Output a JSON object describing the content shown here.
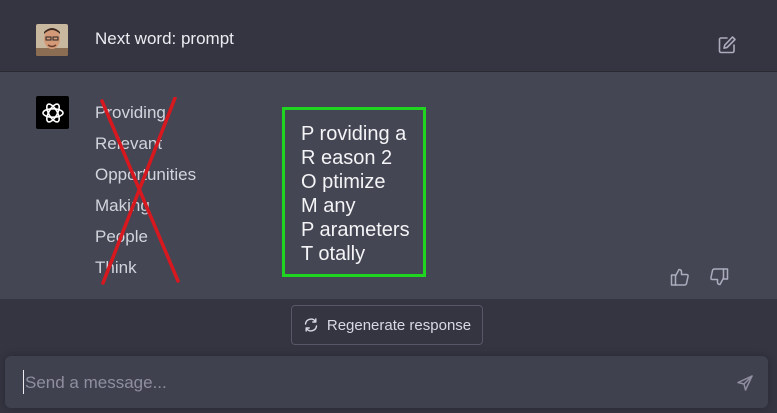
{
  "user_message": {
    "text": "Next word: prompt"
  },
  "assistant_message": {
    "words": [
      "Providing",
      "Relevant",
      "Opportunities",
      "Making",
      "People",
      "Think"
    ],
    "acronym_lines": [
      "P roviding a",
      "R eason 2",
      "O ptimize",
      "M any",
      "P arameters",
      "T otally"
    ]
  },
  "controls": {
    "regenerate_label": "Regenerate response",
    "composer_placeholder": "Send a message..."
  },
  "colors": {
    "page_bg": "#343541",
    "assistant_bg": "#444654",
    "box_border": "#1fd51f",
    "cross": "#d8181f"
  },
  "icons": {
    "edit": "edit-icon",
    "thumbs_up": "thumbs-up-icon",
    "thumbs_down": "thumbs-down-icon",
    "regenerate": "refresh-icon",
    "send": "send-icon",
    "bot_logo": "openai-logo-icon"
  }
}
